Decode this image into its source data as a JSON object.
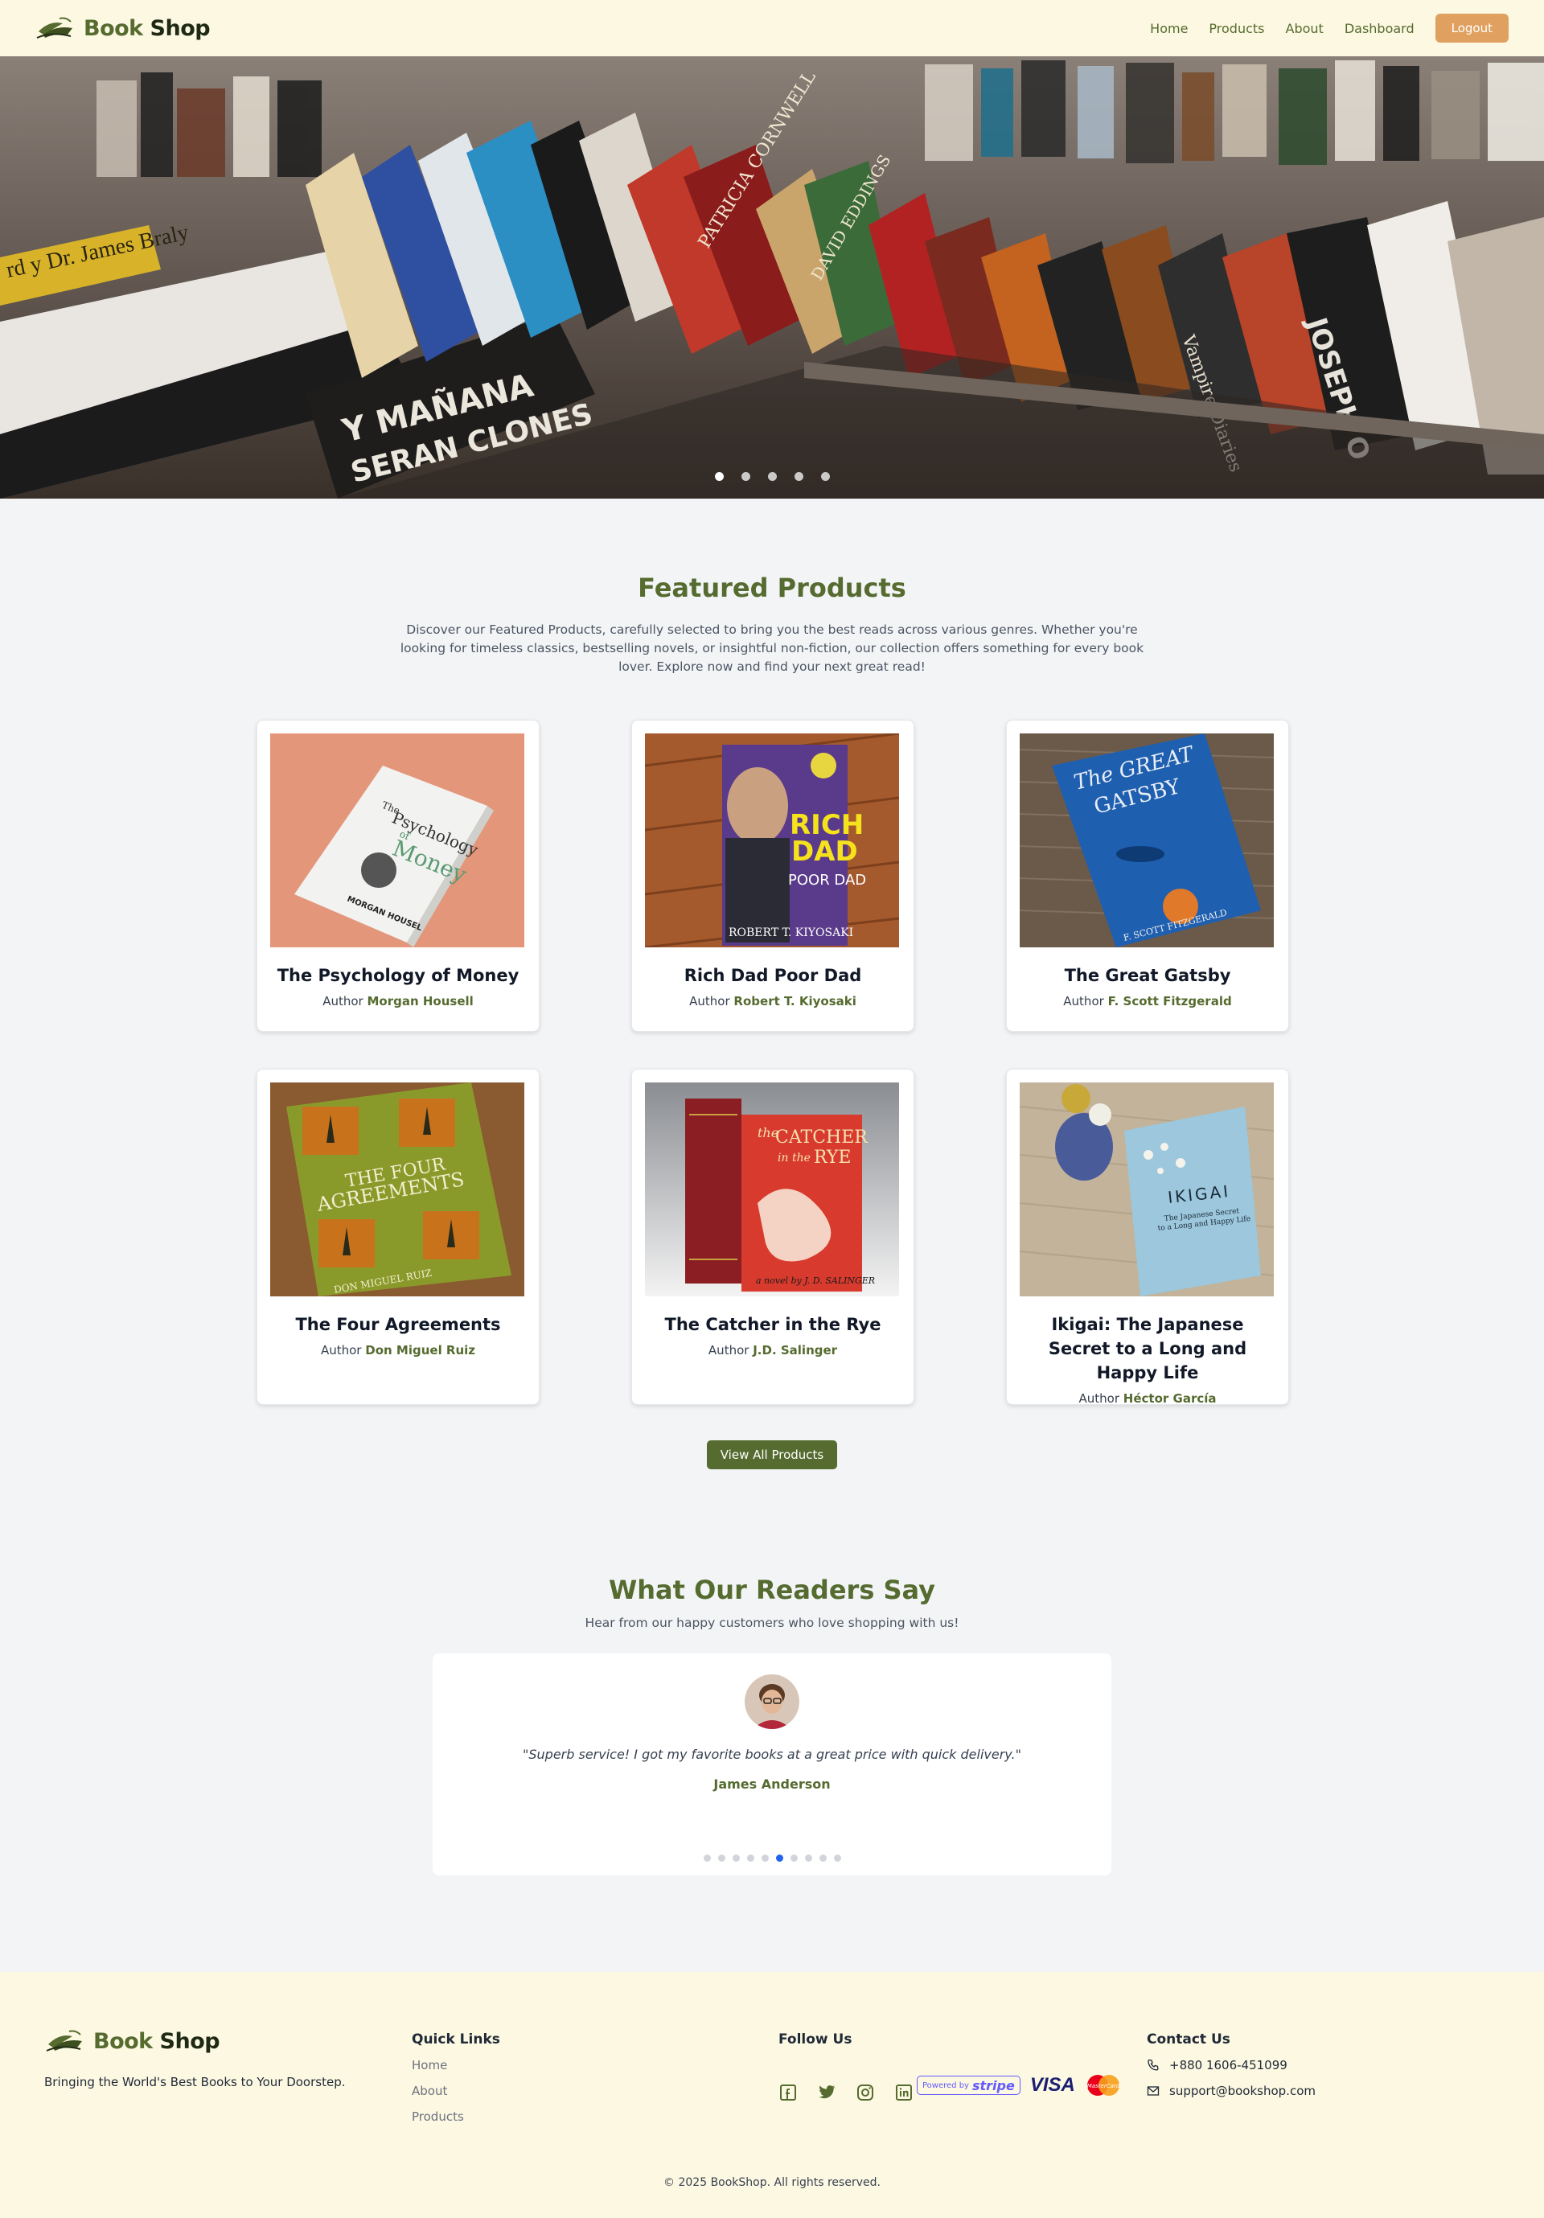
{
  "nav": {
    "brand_part1": "Book",
    "brand_part2": "Shop",
    "links": [
      "Home",
      "Products",
      "About",
      "Dashboard"
    ],
    "logout_label": "Logout"
  },
  "hero": {
    "spine_texts": [
      "rd y Dr. James Braly",
      "Y MAÑANA",
      "SERAN CLONES",
      "PATRICIA CORNWELL",
      "DAVID EDDINGS",
      "Vampire Diaries",
      "JOSEPH O"
    ],
    "slide_count": 5,
    "active_slide": 1
  },
  "featured": {
    "title": "Featured Products",
    "description": "Discover our Featured Products, carefully selected to bring you the best reads across various genres. Whether you're looking for timeless classics, bestselling novels, or insightful non-fiction, our collection offers something for every book lover. Explore now and find your next great read!",
    "author_prefix": "Author",
    "products": [
      {
        "title": "The Psychology of Money",
        "author": "Morgan Housell",
        "cover_text": [
          "The",
          "Psychology",
          "of",
          "Money",
          "MORGAN HOUSEL"
        ]
      },
      {
        "title": "Rich Dad Poor Dad",
        "author": "Robert T. Kiyosaki",
        "cover_text": [
          "RICH",
          "DAD",
          "POOR DAD",
          "ROBERT T. KIYOSAKI"
        ]
      },
      {
        "title": "The Great Gatsby",
        "author": "F. Scott Fitzgerald",
        "cover_text": [
          "The GREAT",
          "GATSBY",
          "F. SCOTT FITZGERALD"
        ]
      },
      {
        "title": "The Four Agreements",
        "author": "Don Miguel Ruiz",
        "cover_text": [
          "THE FOUR",
          "AGREEMENTS",
          "DON MIGUEL RUIZ"
        ]
      },
      {
        "title": "The Catcher in the Rye",
        "author": "J.D. Salinger",
        "cover_text": [
          "the",
          "CATCHER",
          "in the",
          "RYE",
          "a novel by J. D. SALINGER"
        ]
      },
      {
        "title": "Ikigai: The Japanese Secret to a Long and Happy Life",
        "author": "Héctor García",
        "cover_text": [
          "IKIGAI",
          "The Japanese Secret",
          "to a Long and Happy Life"
        ]
      }
    ],
    "view_all_label": "View All Products"
  },
  "readers": {
    "title": "What Our Readers Say",
    "subtitle": "Hear from our happy customers who love shopping with us!",
    "quote": "\"Superb service! I got my favorite books at a great price with quick delivery.\"",
    "name": "James Anderson",
    "dot_count": 10,
    "active_dot": 6
  },
  "footer": {
    "brand_part1": "Book",
    "brand_part2": "Shop",
    "tagline": "Bringing the World's Best Books to Your Doorstep.",
    "quick_links_title": "Quick Links",
    "quick_links": [
      "Home",
      "About",
      "Products"
    ],
    "follow_title": "Follow Us",
    "social_icons": [
      "facebook-icon",
      "twitter-icon",
      "instagram-icon",
      "linkedin-icon"
    ],
    "stripe_prefix": "Powered by",
    "stripe_word": "stripe",
    "visa_label": "VISA",
    "mastercard_label": "MasterCard",
    "contact_title": "Contact Us",
    "phone": "+880 1606-451099",
    "email": "support@bookshop.com",
    "copyright": "© 2025 BookShop. All rights reserved."
  },
  "colors": {
    "brand_green": "#556b2f",
    "cream": "#fdf8e1",
    "logout_orange": "#e0a060",
    "active_dot_blue": "#2563eb"
  }
}
